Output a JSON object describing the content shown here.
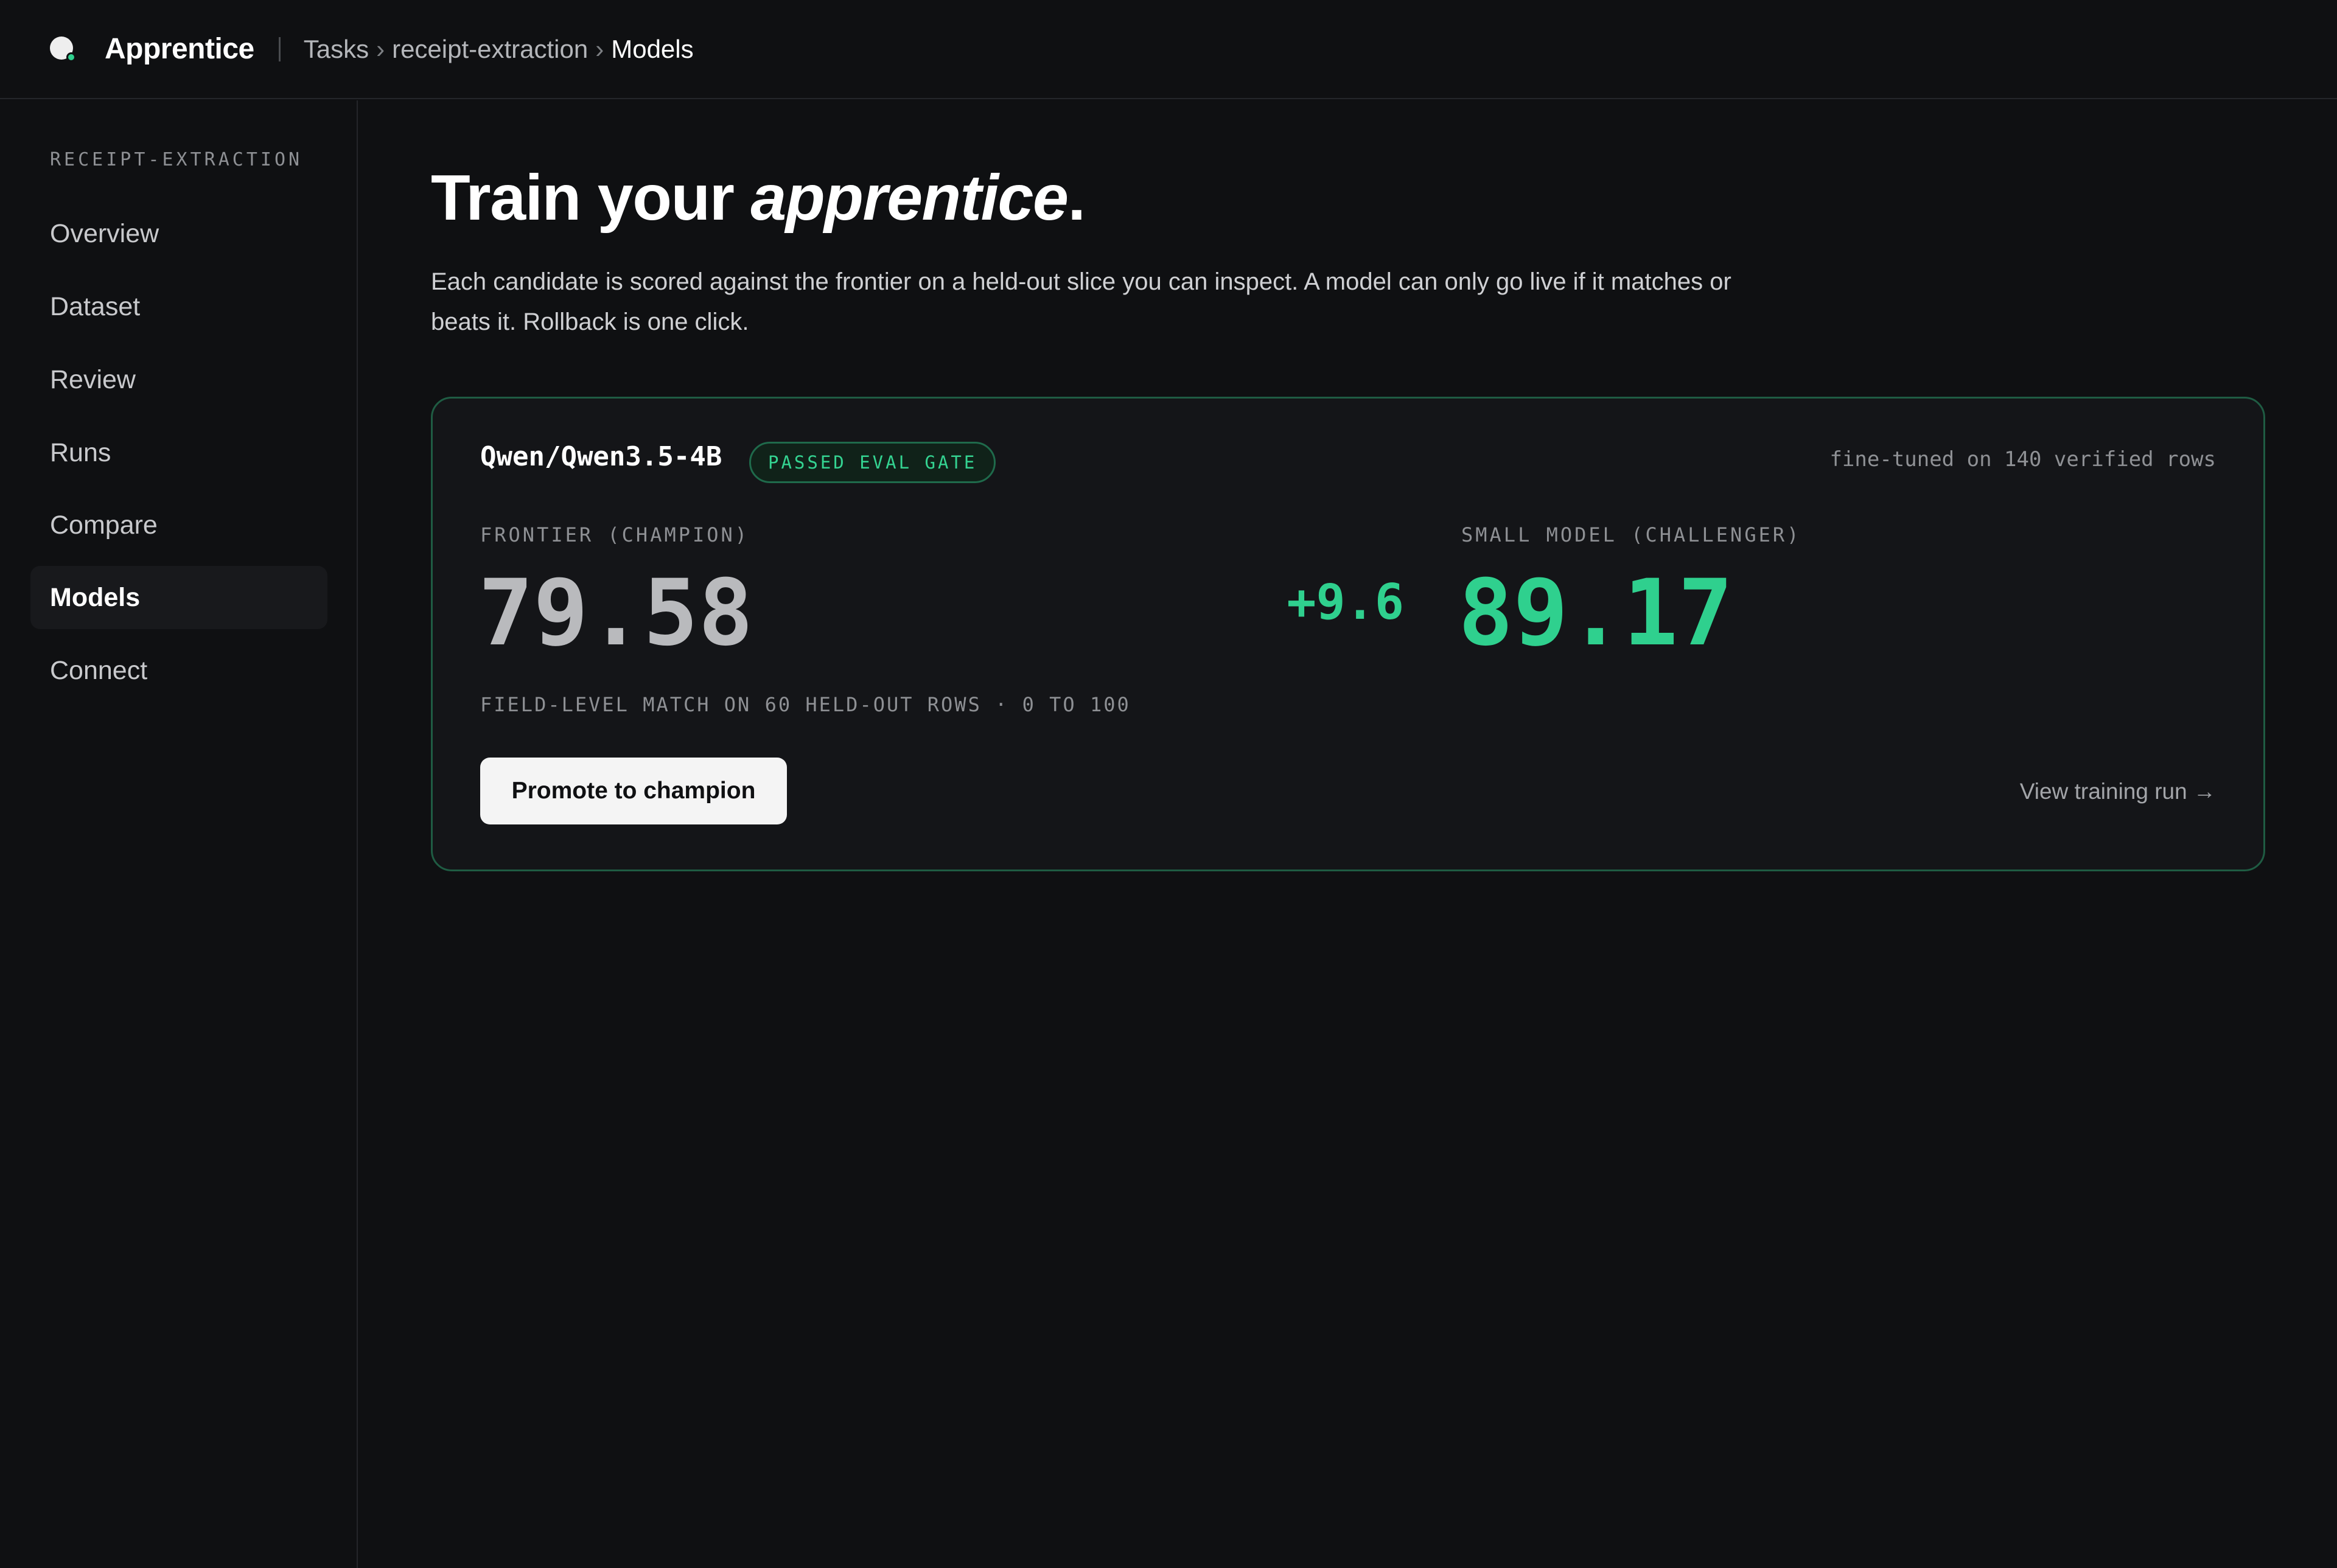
{
  "app": {
    "name": "Apprentice",
    "logo_icon": "apprentice-logo-icon"
  },
  "breadcrumb": {
    "items": [
      "Tasks",
      "receipt-extraction",
      "Models"
    ],
    "separator": "›"
  },
  "sidebar": {
    "heading": "RECEIPT-EXTRACTION",
    "items": [
      {
        "label": "Overview",
        "active": false
      },
      {
        "label": "Dataset",
        "active": false
      },
      {
        "label": "Review",
        "active": false
      },
      {
        "label": "Runs",
        "active": false
      },
      {
        "label": "Compare",
        "active": false
      },
      {
        "label": "Models",
        "active": true
      },
      {
        "label": "Connect",
        "active": false
      }
    ]
  },
  "main": {
    "title_prefix": "Train your ",
    "title_emphasis": "apprentice",
    "title_suffix": ".",
    "description": "Each candidate is scored against the frontier on a held-out slice you can inspect. A model can only go live if it matches or beats it. Rollback is one click."
  },
  "card": {
    "model_name": "Qwen/Qwen3.5-4B",
    "badge": "PASSED EVAL GATE",
    "note": "fine-tuned on 140 verified rows",
    "champion_label": "FRONTIER (CHAMPION)",
    "champion_score": "79.58",
    "delta": "+9.6",
    "challenger_label": "SMALL MODEL (CHALLENGER)",
    "challenger_score": "89.17",
    "metric_note": "FIELD-LEVEL MATCH ON 60 HELD-OUT ROWS · 0 TO 100",
    "promote_button": "Promote to champion",
    "training_link": "View training run →"
  },
  "colors": {
    "background": "#0f1012",
    "accent": "#2fd08e",
    "card_border": "#1f5c43",
    "button_bg": "#f4f4f4"
  }
}
